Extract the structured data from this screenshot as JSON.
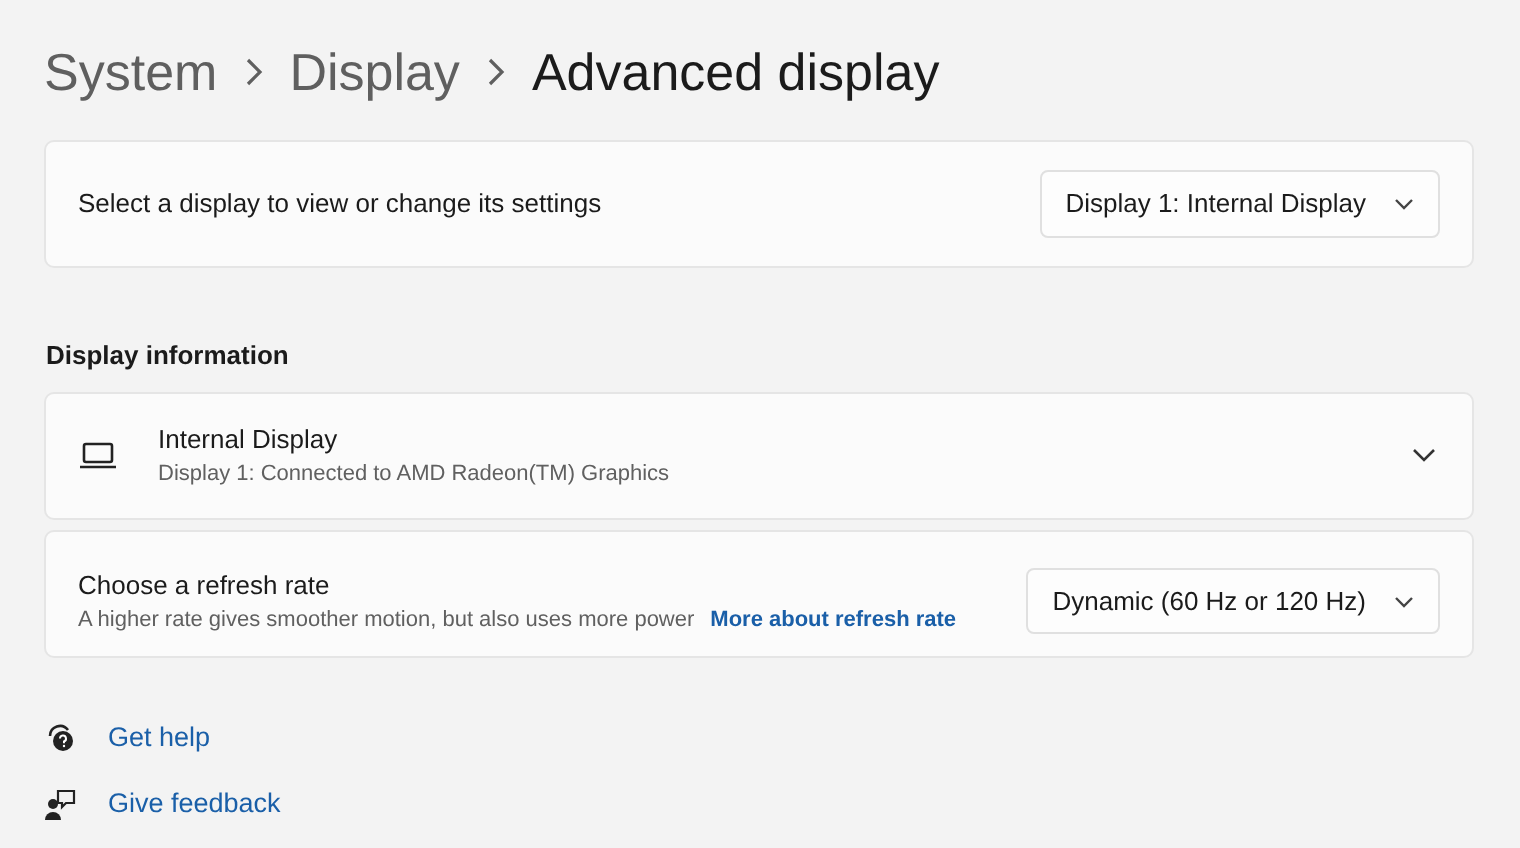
{
  "breadcrumb": [
    {
      "label": "System",
      "selected": false
    },
    {
      "label": "Display",
      "selected": false
    },
    {
      "label": "Advanced display",
      "selected": true
    }
  ],
  "display_select": {
    "label": "Select a display to view or change its settings",
    "value": "Display 1: Internal Display"
  },
  "section_title": "Display information",
  "display_info": {
    "title": "Internal Display",
    "subtitle": "Display 1: Connected to AMD Radeon(TM) Graphics",
    "expanded": false
  },
  "refresh_rate": {
    "title": "Choose a refresh rate",
    "description": "A higher rate gives smoother motion, but also uses more power",
    "link": "More about refresh rate",
    "value": "Dynamic (60 Hz or 120 Hz)"
  },
  "footer_links": [
    {
      "kind": "help",
      "label": "Get help"
    },
    {
      "kind": "feedback",
      "label": "Give feedback"
    }
  ]
}
